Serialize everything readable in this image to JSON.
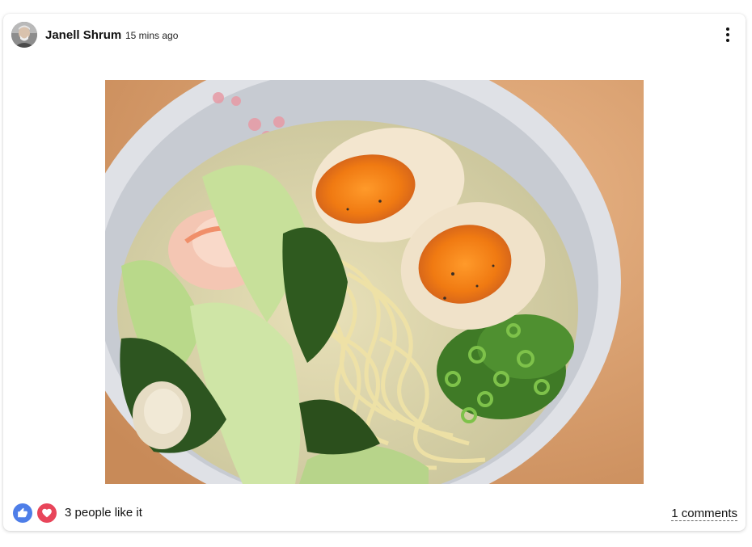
{
  "post": {
    "author": "Janell Shrum",
    "time_ago": "15 mins ago",
    "avatar_icon": "user-avatar",
    "menu_icon": "more-vertical-icon",
    "image_alt": "Bowl of ramen with soft-boiled eggs, shrimp, bok choy and green onions"
  },
  "footer": {
    "likes_text": "3 people like it",
    "comments_text": "1 comments",
    "reactions": [
      "thumbs-up-icon",
      "heart-icon"
    ]
  },
  "colors": {
    "like": "#4e7ee8",
    "love": "#e8455a",
    "card_bg": "#ffffff"
  }
}
